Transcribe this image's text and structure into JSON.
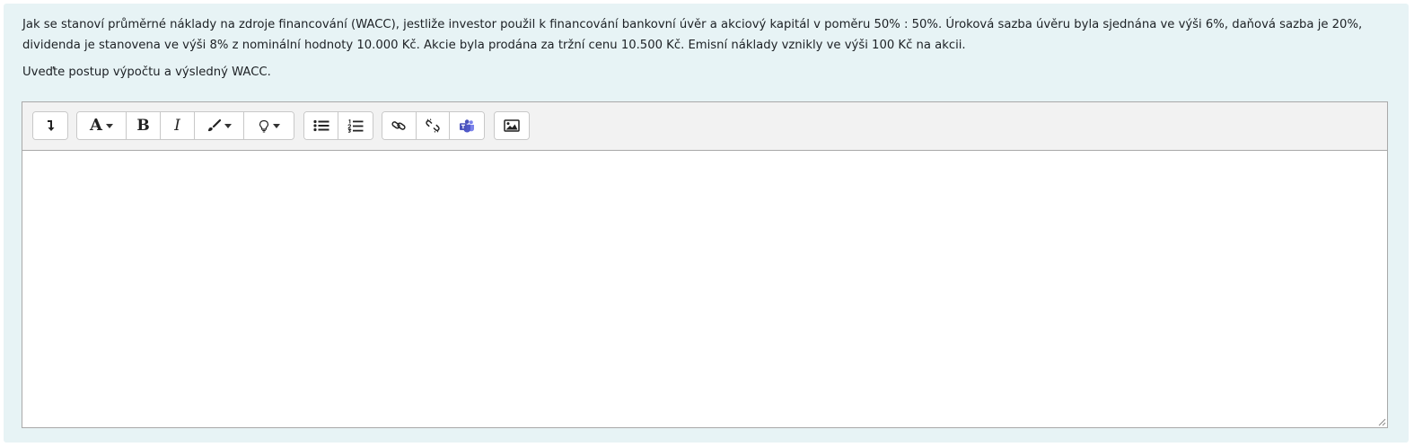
{
  "question": {
    "text": "Jak se stanoví průměrné náklady na zdroje financování (WACC), jestliže investor použil k financování bankovní úvěr a akciový kapitál v poměru 50% : 50%. Úroková sazba úvěru byla sjednána ve výši 6%, daňová sazba je 20%, dividenda je stanovena ve výši 8% z nominální hodnoty 10.000 Kč. Akcie byla prodána za tržní cenu 10.500 Kč. Emisní náklady vznikly ve výši 100 Kč na akcii.",
    "instruction": "Uveďte postup výpočtu a výsledný WACC."
  },
  "editor": {
    "content": "",
    "toolbar": {
      "font_label": "A",
      "bold_label": "B",
      "italic_label": "I",
      "icons": [
        "toggle-toolbar-icon",
        "font-style-icon",
        "bold-icon",
        "italic-icon",
        "brush-icon",
        "lightbulb-icon",
        "unordered-list-icon",
        "ordered-list-icon",
        "link-icon",
        "unlink-icon",
        "teams-icon",
        "image-icon"
      ]
    }
  },
  "colors": {
    "panel_background": "#e7f3f5",
    "toolbar_background": "#f2f2f2",
    "editor_border": "#a9a9a9",
    "teams_accent": "#4b53bc"
  }
}
